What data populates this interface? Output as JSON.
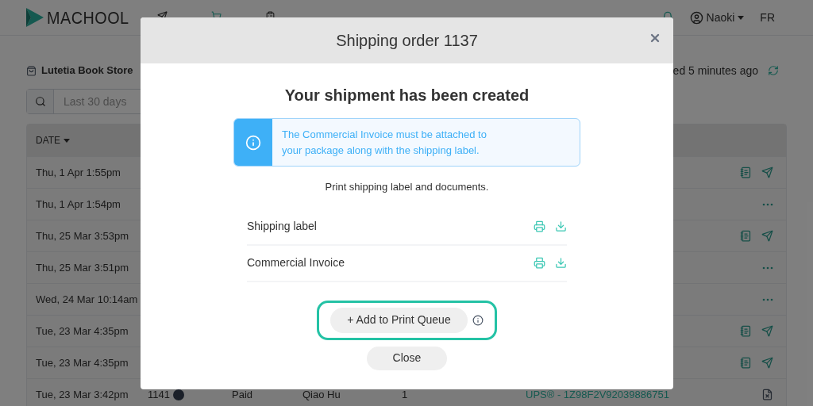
{
  "nav": {
    "logo": "MACHOOL",
    "items": [
      {
        "kind": "ship",
        "selected": false
      },
      {
        "kind": "ecommerce",
        "selected": true
      },
      {
        "kind": "manage",
        "selected": false
      }
    ],
    "user": "Naoki",
    "language": "FR"
  },
  "store": {
    "name": "Lutetia Book Store",
    "sync_text": "ed 5 minutes ago"
  },
  "filter": {
    "placeholder": "Last 30 days"
  },
  "table": {
    "columns": [
      "DATE"
    ],
    "rows": [
      {
        "date": "Thu, 1 Apr 1:55pm",
        "kind": "icons"
      },
      {
        "date": "Thu, 1 Apr 1:54pm",
        "kind": "more"
      },
      {
        "date": "Thu, 25 Mar 3:53pm",
        "kind": "icons"
      },
      {
        "date": "Thu, 25 Mar 3:51pm",
        "kind": "more"
      },
      {
        "date": "Wed, 24 Mar 10:14am",
        "kind": "more"
      },
      {
        "date": "Tue, 23 Mar 4:35pm",
        "kind": "icons"
      },
      {
        "date": "Tue, 23 Mar 4:35pm",
        "kind": "icons"
      },
      {
        "date": "Tue, 23 Mar 3:42pm",
        "kind": "document",
        "order": "1141",
        "status": "Paid",
        "customer": "Qiao Hu",
        "quantity": "1",
        "tracking": "UPS® - 1Z98F2V92039886751"
      }
    ]
  },
  "modal": {
    "title": "Shipping order 1137",
    "heading": "Your shipment has been created",
    "alert": "The Commercial Invoice must be attached to your package along with the shipping label.",
    "instruction": "Print shipping label and documents.",
    "documents": [
      {
        "name": "Shipping label"
      },
      {
        "name": "Commercial Invoice"
      }
    ],
    "queue_button": "+ Add to Print Queue",
    "highlighted": true,
    "close_button": "Close"
  }
}
